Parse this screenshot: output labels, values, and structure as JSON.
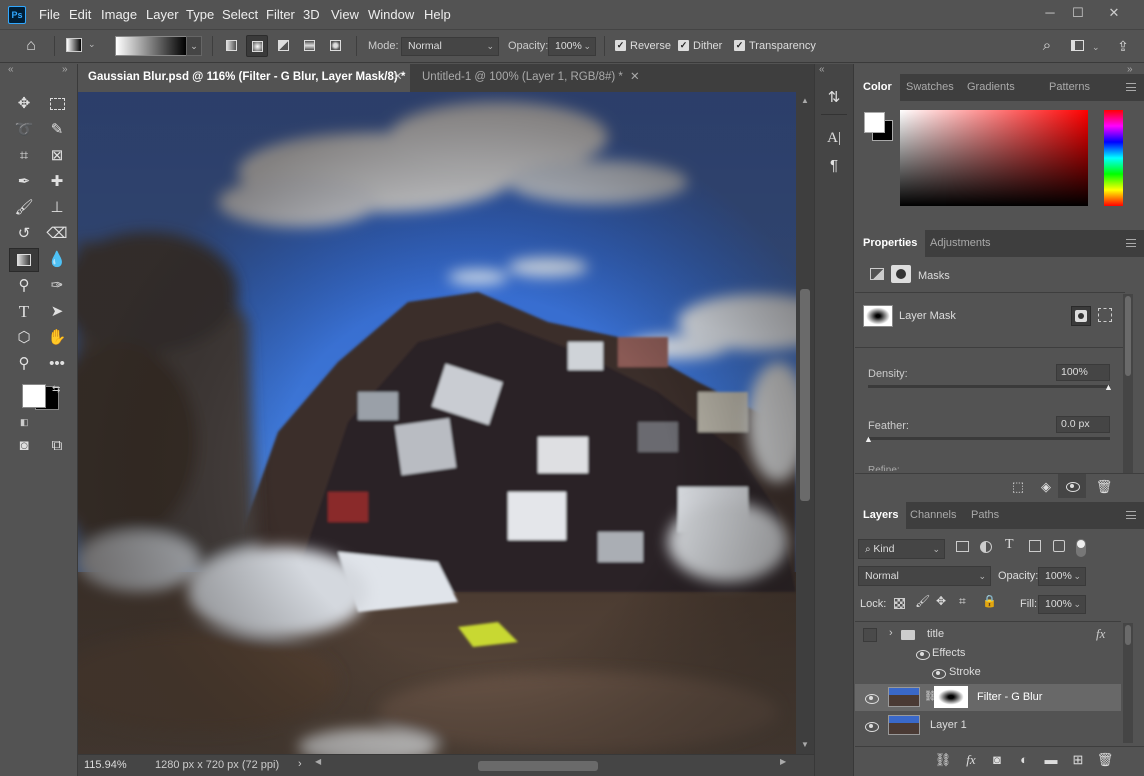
{
  "menubar": {
    "logo": "Ps",
    "items": [
      "File",
      "Edit",
      "Image",
      "Layer",
      "Type",
      "Select",
      "Filter",
      "3D",
      "View",
      "Window",
      "Help"
    ]
  },
  "options": {
    "mode_label": "Mode:",
    "mode_value": "Normal",
    "opacity_label": "Opacity:",
    "opacity_value": "100%",
    "reverse_label": "Reverse",
    "dither_label": "Dither",
    "transparency_label": "Transparency"
  },
  "tabs": [
    {
      "label": "Gaussian Blur.psd @ 116% (Filter - G Blur, Layer Mask/8) *"
    },
    {
      "label": "Untitled-1 @ 100% (Layer 1, RGB/8#) *"
    }
  ],
  "status": {
    "zoom": "115.94%",
    "doc_size": "1280 px x 720 px (72 ppi)"
  },
  "color_panel": {
    "tabs": [
      "Color",
      "Swatches",
      "Gradients",
      "Patterns"
    ]
  },
  "properties_panel": {
    "tabs": [
      "Properties",
      "Adjustments"
    ],
    "masks_label": "Masks",
    "layer_mask_label": "Layer Mask",
    "density_label": "Density:",
    "density_value": "100%",
    "feather_label": "Feather:",
    "feather_value": "0.0 px",
    "refine_label": "Refine:"
  },
  "layers_panel": {
    "tabs": [
      "Layers",
      "Channels",
      "Paths"
    ],
    "filter_kind": "Kind",
    "blend_mode": "Normal",
    "opacity_label": "Opacity:",
    "opacity_value": "100%",
    "lock_label": "Lock:",
    "fill_label": "Fill:",
    "fill_value": "100%",
    "layers": {
      "title": "title",
      "effects": "Effects",
      "stroke": "Stroke",
      "filter_layer": "Filter - G Blur",
      "layer1": "Layer 1"
    }
  },
  "colors": {
    "panel_bg": "#535353",
    "selected_row": "#686868"
  }
}
